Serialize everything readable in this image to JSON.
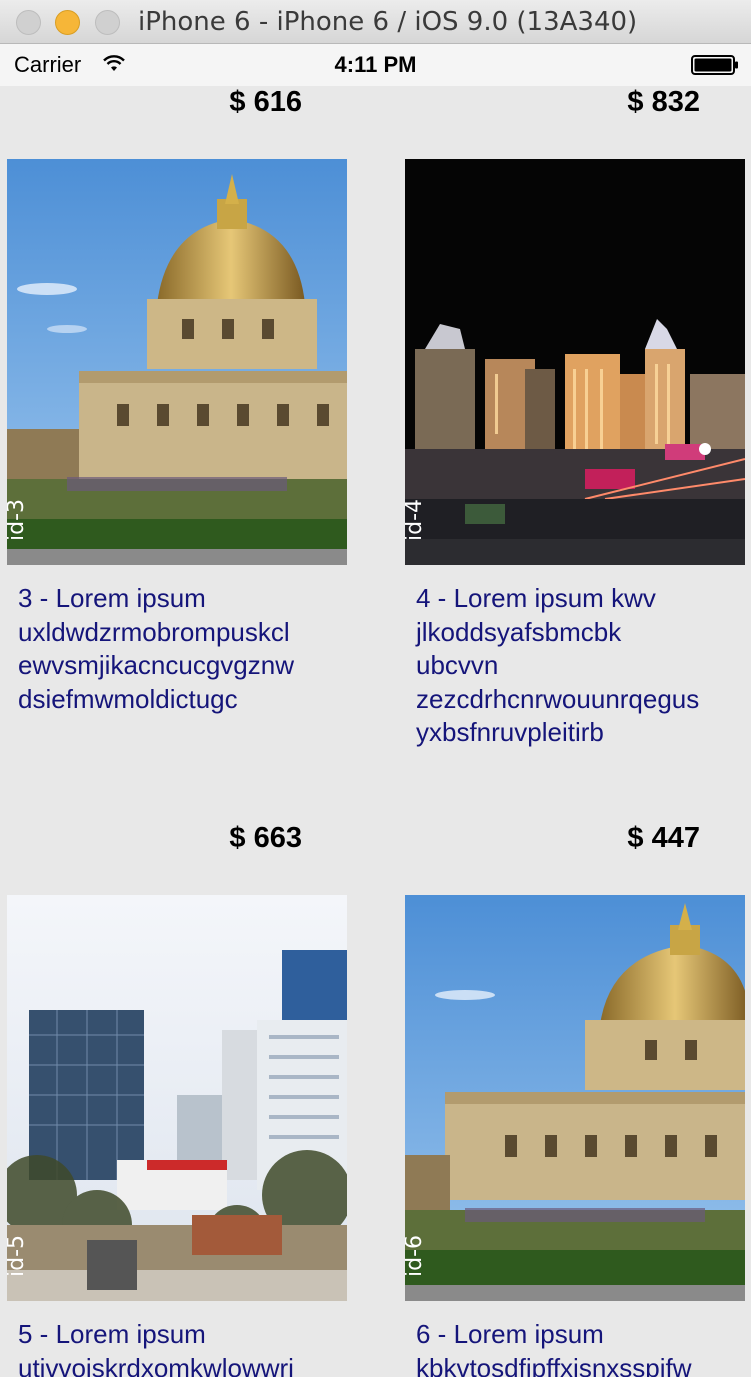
{
  "window": {
    "title": "iPhone 6 - iPhone 6 / iOS 9.0 (13A340)"
  },
  "status_bar": {
    "carrier": "Carrier",
    "time": "4:11 PM",
    "icons": [
      "wifi-icon",
      "battery-icon"
    ]
  },
  "items": [
    {
      "price": "$ 616",
      "image_id": "id-3",
      "image_subject": "golden dome building",
      "lines": [
        "3 - Lorem ipsum",
        "uxldwdzrmobrompuskcl",
        "ewvsmjikacncucgvgznw",
        "dsiefmwmoldictugc"
      ]
    },
    {
      "price": "$ 832",
      "image_id": "id-4",
      "image_subject": "city skyline at night",
      "lines": [
        "4 - Lorem ipsum kwv",
        "jlkoddsyafsbmcbk",
        "ubcvvn",
        "zezcdrhcnrwouunrqegus",
        "yxbsfnruvpleitirb"
      ]
    },
    {
      "price": "$ 663",
      "image_id": "id-5",
      "image_subject": "office towers",
      "lines": [
        "5 - Lorem ipsum",
        "utivvoiskrdxomkwlowwri"
      ]
    },
    {
      "price": "$ 447",
      "image_id": "id-6",
      "image_subject": "golden dome building",
      "lines": [
        "6 - Lorem ipsum",
        "kbkvtosdfipffxisnxsspifw"
      ]
    }
  ],
  "colors": {
    "description_text": "#15157a",
    "price_text": "#000000",
    "background": "#e8e8e8"
  }
}
